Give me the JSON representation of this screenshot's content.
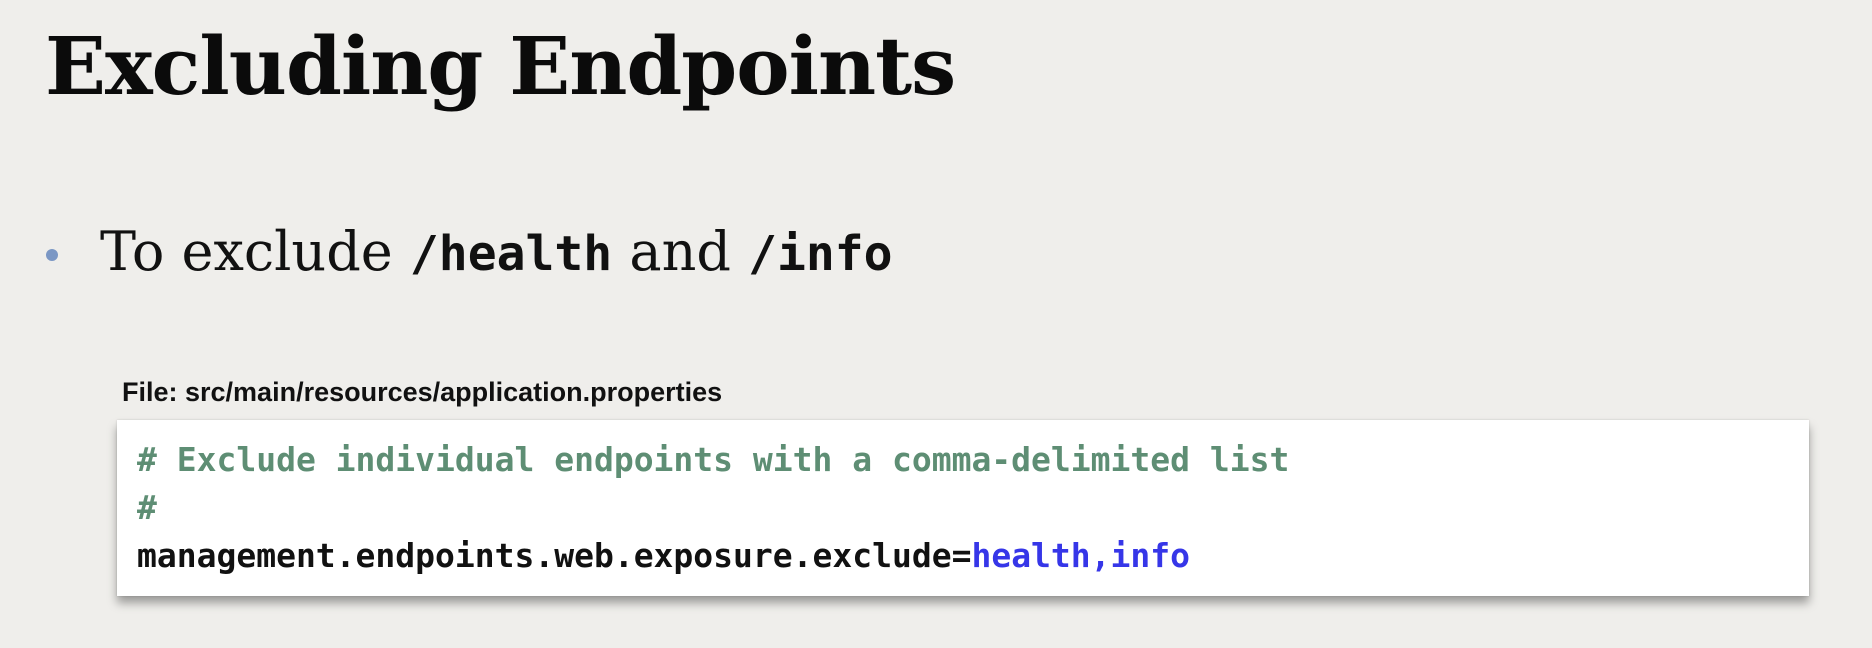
{
  "slide": {
    "title": "Excluding Endpoints",
    "bullet": {
      "prefix": "To exclude ",
      "code1": "/health",
      "middle": " and ",
      "code2": "/info"
    },
    "file_label": "File: src/main/resources/application.properties",
    "code": {
      "comment_line1": "# Exclude individual endpoints with a comma-delimited list",
      "comment_line2": "#",
      "property_key": "management.endpoints.web.exposure.exclude=",
      "property_value": "health,info"
    }
  },
  "colors": {
    "background": "#efeeeb",
    "bullet": "#7b97c4",
    "comment": "#5e8e74",
    "value": "#3636e8"
  }
}
